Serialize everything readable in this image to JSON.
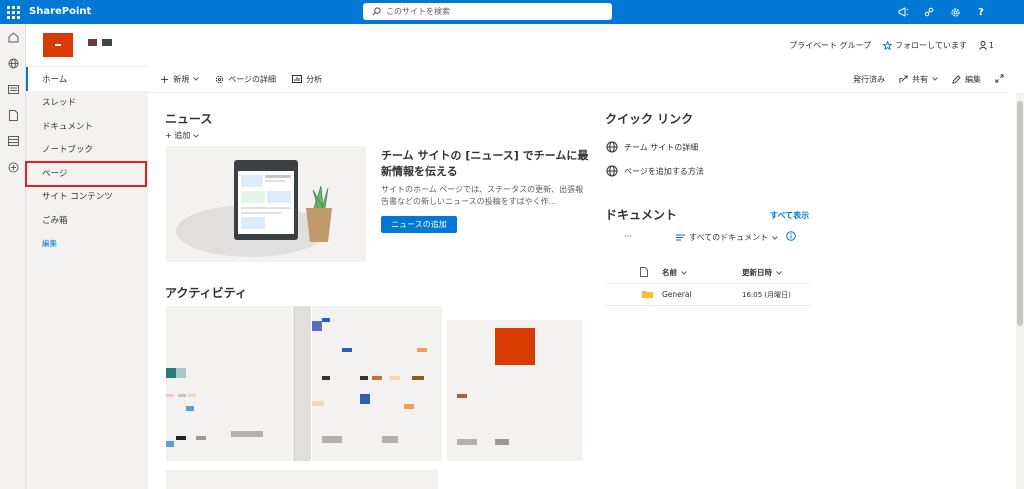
{
  "topbar": {
    "app_name": "SharePoint",
    "search_placeholder": "このサイトを検索",
    "help": "?"
  },
  "site_header": {
    "privacy": "プライベート グループ",
    "follow": "フォローしています",
    "members": "1"
  },
  "leftnav": {
    "items": [
      {
        "label": "ホーム"
      },
      {
        "label": "スレッド"
      },
      {
        "label": "ドキュメント"
      },
      {
        "label": "ノートブック"
      },
      {
        "label": "ページ"
      },
      {
        "label": "サイト コンテンツ"
      },
      {
        "label": "ごみ箱"
      },
      {
        "label": "編集"
      }
    ]
  },
  "command_bar": {
    "new": "新規",
    "page_details": "ページの詳細",
    "analytics": "分析",
    "published": "発行済み",
    "share": "共有",
    "edit": "編集"
  },
  "news": {
    "heading": "ニュース",
    "add": "追加",
    "title": "チーム サイトの [ニュース] でチームに最新情報を伝える",
    "description": "サイトのホーム ページでは、ステータスの更新、出張報告書などの新しいニュースの投稿をすばやく作...",
    "button": "ニュースの追加"
  },
  "activity": {
    "heading": "アクティビティ"
  },
  "quick_links": {
    "heading": "クイック リンク",
    "items": [
      {
        "label": "チーム サイトの詳細"
      },
      {
        "label": "ページを追加する方法"
      }
    ]
  },
  "documents": {
    "heading": "ドキュメント",
    "show_all": "すべて表示",
    "view": "すべてのドキュメント",
    "more": "···",
    "columns": {
      "name": "名前",
      "modified": "更新日時"
    },
    "rows": [
      {
        "name": "General",
        "modified": "16:05 (月曜日)"
      }
    ]
  },
  "colors": {
    "brand_blue": "#0078d4",
    "logo_orange": "#d83b01",
    "highlight_red": "#e41e26"
  }
}
